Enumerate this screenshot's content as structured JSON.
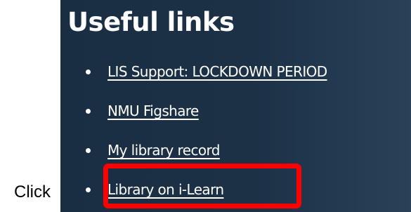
{
  "instruction": {
    "prefix": "Click"
  },
  "useful_links": {
    "title": "Useful links",
    "items": [
      {
        "label": "LIS Support: LOCKDOWN PERIOD"
      },
      {
        "label": "NMU Figshare"
      },
      {
        "label": "My library record"
      },
      {
        "label": "Library on i-Learn"
      }
    ]
  },
  "highlight": {
    "target_index": 3,
    "color": "#ff0000"
  },
  "colors": {
    "panel_background": "#1c3146",
    "link_text": "#ffffff"
  }
}
